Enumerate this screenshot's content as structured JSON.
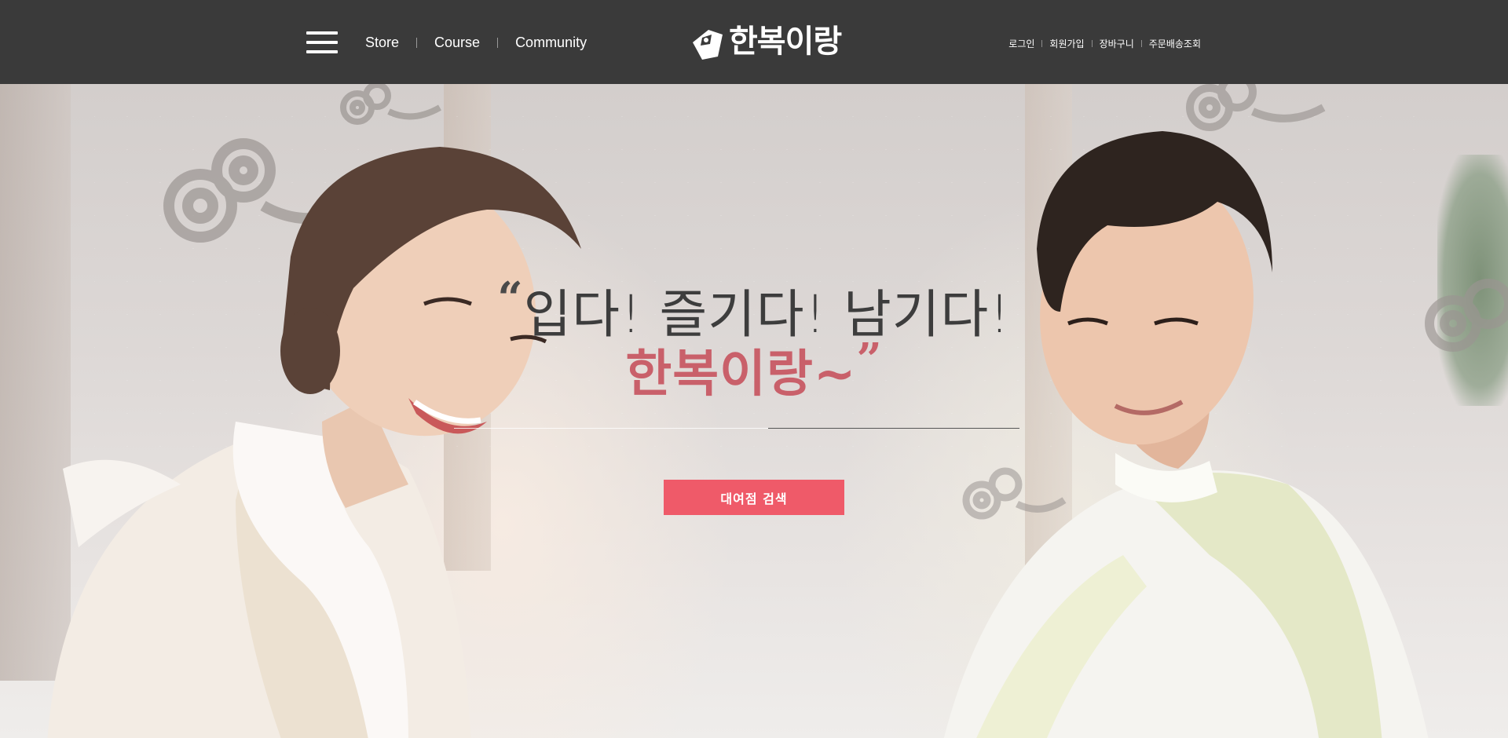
{
  "header": {
    "menu_icon": "hamburger-menu-icon",
    "nav": [
      {
        "label": "Store"
      },
      {
        "label": "Course"
      },
      {
        "label": "Community"
      }
    ],
    "logo_text": "한복이랑",
    "util_nav": [
      {
        "label": "로그인"
      },
      {
        "label": "회원가입"
      },
      {
        "label": "장바구니"
      },
      {
        "label": "주문배송조회"
      }
    ],
    "background_color": "#3a3a3a"
  },
  "hero": {
    "open_quote": "“",
    "line1": "입다! 즐기다! 남기다!",
    "line2": "한복이랑~",
    "close_quote": "”",
    "button_label": "대여점 검색",
    "accent_color": "#ef5a69",
    "headline_pink": "#c9606a"
  }
}
